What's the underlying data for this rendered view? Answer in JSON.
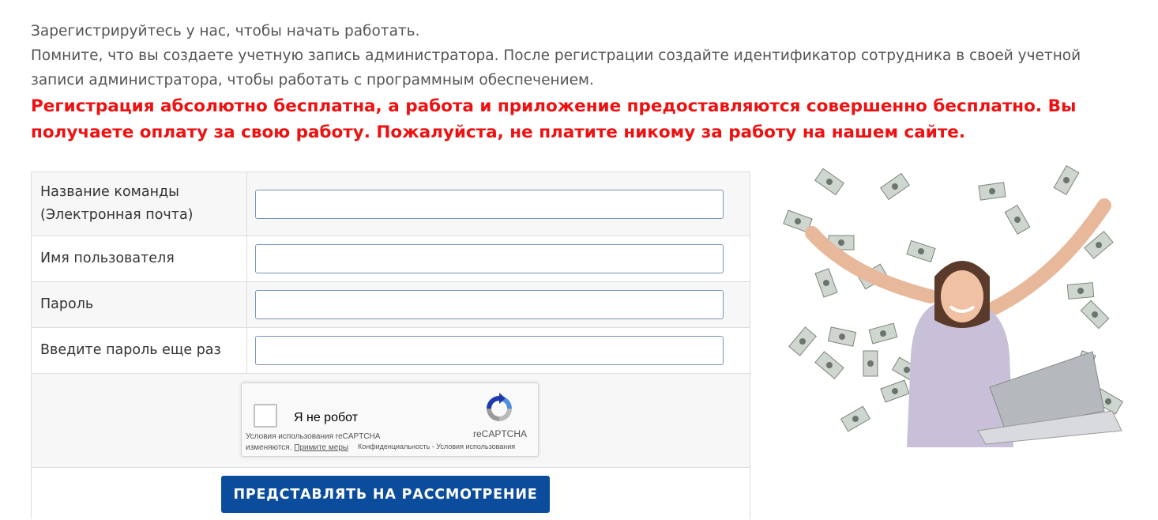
{
  "intro": {
    "line1": "Зарегистрируйтесь у нас, чтобы начать работать.",
    "line2": "Помните, что вы создаете учетную запись администратора. После регистрации создайте идентификатор сотрудника в своей учетной записи администратора, чтобы работать с программным обеспечением.",
    "warning": "Регистрация абсолютно бесплатна, а работа и приложение предоставляются совершенно бесплатно. Вы получаете оплату за свою работу. Пожалуйста, не платите никому за работу на нашем сайте."
  },
  "form": {
    "team_label": "Название команды (Электронная почта)",
    "team_value": "",
    "username_label": "Имя пользователя",
    "username_value": "",
    "password_label": "Пароль",
    "password_value": "",
    "repeat_label": "Введите пароль еще раз",
    "repeat_value": "",
    "submit_label": "ПРЕДСТАВЛЯТЬ НА РАССМОТРЕНИЕ"
  },
  "recaptcha": {
    "checkbox_label": "Я не робот",
    "brand": "reCAPTCHA",
    "terms_text": "Условия использования reCAPTCHA изменяются.",
    "terms_link": "Примите меры",
    "links": "Конфиденциальность - Условия использования"
  },
  "colors": {
    "warning": "#ee1111",
    "button": "#0b4d9c",
    "input_border": "#7a95b8"
  }
}
